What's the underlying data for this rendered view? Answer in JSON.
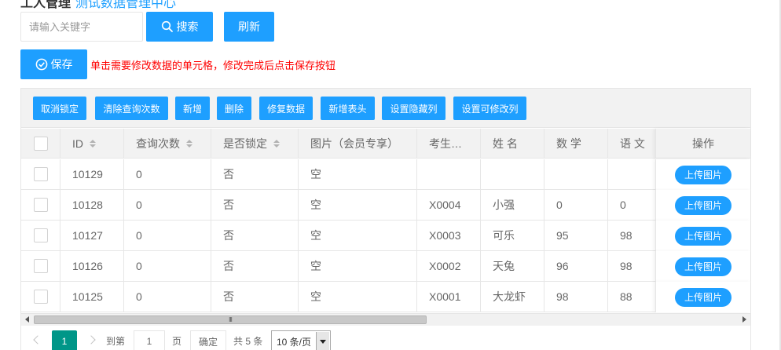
{
  "header": {
    "title_fragment": "工人管理",
    "link_fragment": "测试数据管理中心"
  },
  "search": {
    "placeholder": "请输入关键字",
    "search_label": "搜索",
    "refresh_label": "刷新"
  },
  "save": {
    "label": "保存",
    "hint": "单击需要修改数据的单元格，修改完成后点击保存按钮"
  },
  "toolbar": {
    "buttons": [
      "取消锁定",
      "清除查询次数",
      "新增",
      "删除",
      "修复数据",
      "新增表头",
      "设置隐藏列",
      "设置可修改列"
    ]
  },
  "table": {
    "columns": [
      "ID",
      "查询次数",
      "是否锁定",
      "图片（会员专享）",
      "考生…",
      "姓 名",
      "数 学",
      "语 文"
    ],
    "ops_header": "操作",
    "upload_label": "上传图片",
    "rows": [
      {
        "id": "10129",
        "queries": "0",
        "locked": "否",
        "image": "空",
        "exam_no": "",
        "name": "",
        "math": "",
        "chinese": ""
      },
      {
        "id": "10128",
        "queries": "0",
        "locked": "否",
        "image": "空",
        "exam_no": "X0004",
        "name": "小强",
        "math": "0",
        "chinese": "0"
      },
      {
        "id": "10127",
        "queries": "0",
        "locked": "否",
        "image": "空",
        "exam_no": "X0003",
        "name": "可乐",
        "math": "95",
        "chinese": "98"
      },
      {
        "id": "10126",
        "queries": "0",
        "locked": "否",
        "image": "空",
        "exam_no": "X0002",
        "name": "天兔",
        "math": "96",
        "chinese": "98"
      },
      {
        "id": "10125",
        "queries": "0",
        "locked": "否",
        "image": "空",
        "exam_no": "X0001",
        "name": "大龙虾",
        "math": "98",
        "chinese": "88"
      }
    ]
  },
  "scrollbar": {
    "thumb_grip": "III"
  },
  "pager": {
    "current_page": "1",
    "goto_prefix": "到第",
    "goto_value": "1",
    "page_suffix": "页",
    "confirm_label": "确定",
    "total": "共 5 条",
    "page_size": "10 条/页"
  },
  "colors": {
    "primary": "#1E9FFF",
    "pager_active": "#009688",
    "hint_red": "#ff0000"
  }
}
